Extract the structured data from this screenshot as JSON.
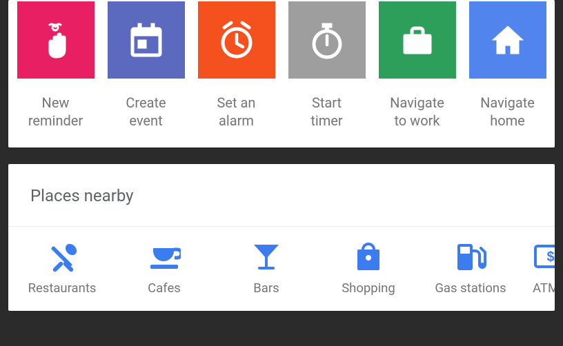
{
  "shortcuts": [
    {
      "id": "new-reminder",
      "label": "New\nreminder",
      "color": "#e82063",
      "icon": "reminder-icon"
    },
    {
      "id": "create-event",
      "label": "Create\nevent",
      "color": "#5b6abf",
      "icon": "calendar-icon"
    },
    {
      "id": "set-alarm",
      "label": "Set an\nalarm",
      "color": "#f4511e",
      "icon": "alarm-icon"
    },
    {
      "id": "start-timer",
      "label": "Start\ntimer",
      "color": "#9e9e9e",
      "icon": "timer-icon"
    },
    {
      "id": "navigate-work",
      "label": "Navigate\nto work",
      "color": "#2e9e5b",
      "icon": "briefcase-icon"
    },
    {
      "id": "navigate-home",
      "label": "Navigate\nhome",
      "color": "#5185ed",
      "icon": "home-icon"
    }
  ],
  "places_header": "Places nearby",
  "places": [
    {
      "id": "restaurants",
      "label": "Restaurants",
      "icon": "restaurant-icon"
    },
    {
      "id": "cafes",
      "label": "Cafes",
      "icon": "cafe-icon"
    },
    {
      "id": "bars",
      "label": "Bars",
      "icon": "bar-icon"
    },
    {
      "id": "shopping",
      "label": "Shopping",
      "icon": "shopping-icon"
    },
    {
      "id": "gas-stations",
      "label": "Gas stations",
      "icon": "gas-icon"
    },
    {
      "id": "atms",
      "label": "ATM",
      "icon": "atm-icon"
    }
  ],
  "colors": {
    "accent_blue": "#3b7cee"
  }
}
